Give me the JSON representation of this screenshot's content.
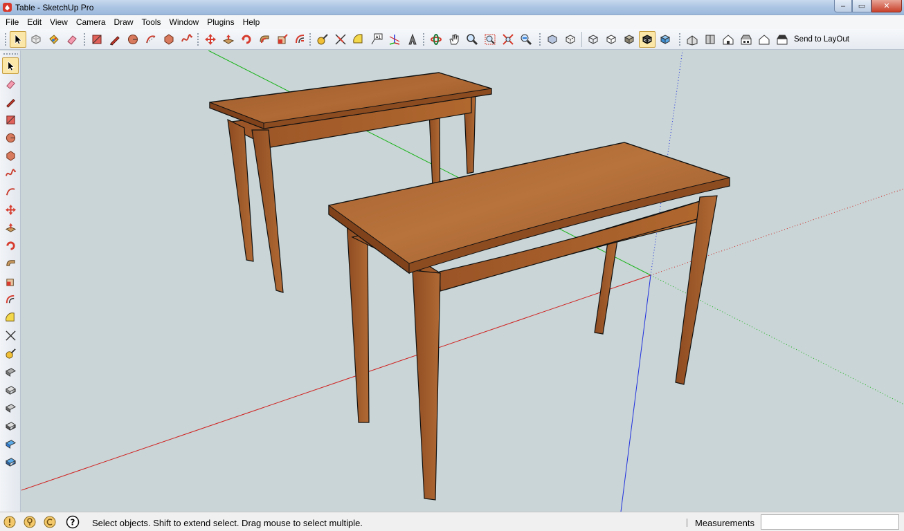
{
  "window": {
    "title": "Table - SketchUp Pro",
    "controls": {
      "minimize": "–",
      "maximize": "▭",
      "close": "✕"
    }
  },
  "menu": [
    "File",
    "Edit",
    "View",
    "Camera",
    "Draw",
    "Tools",
    "Window",
    "Plugins",
    "Help"
  ],
  "toolbar": {
    "send_to_layout_label": "Send to LayOut"
  },
  "status": {
    "hint": "Select objects. Shift to extend select. Drag mouse to select multiple.",
    "measurements_label": "Measurements",
    "measurements_value": ""
  },
  "colors": {
    "viewport_bg": "#c9d5d6",
    "wood": "#a45a2a",
    "axis_red": "#d11f1f",
    "axis_green": "#17b317",
    "axis_blue": "#1f2ee0"
  }
}
